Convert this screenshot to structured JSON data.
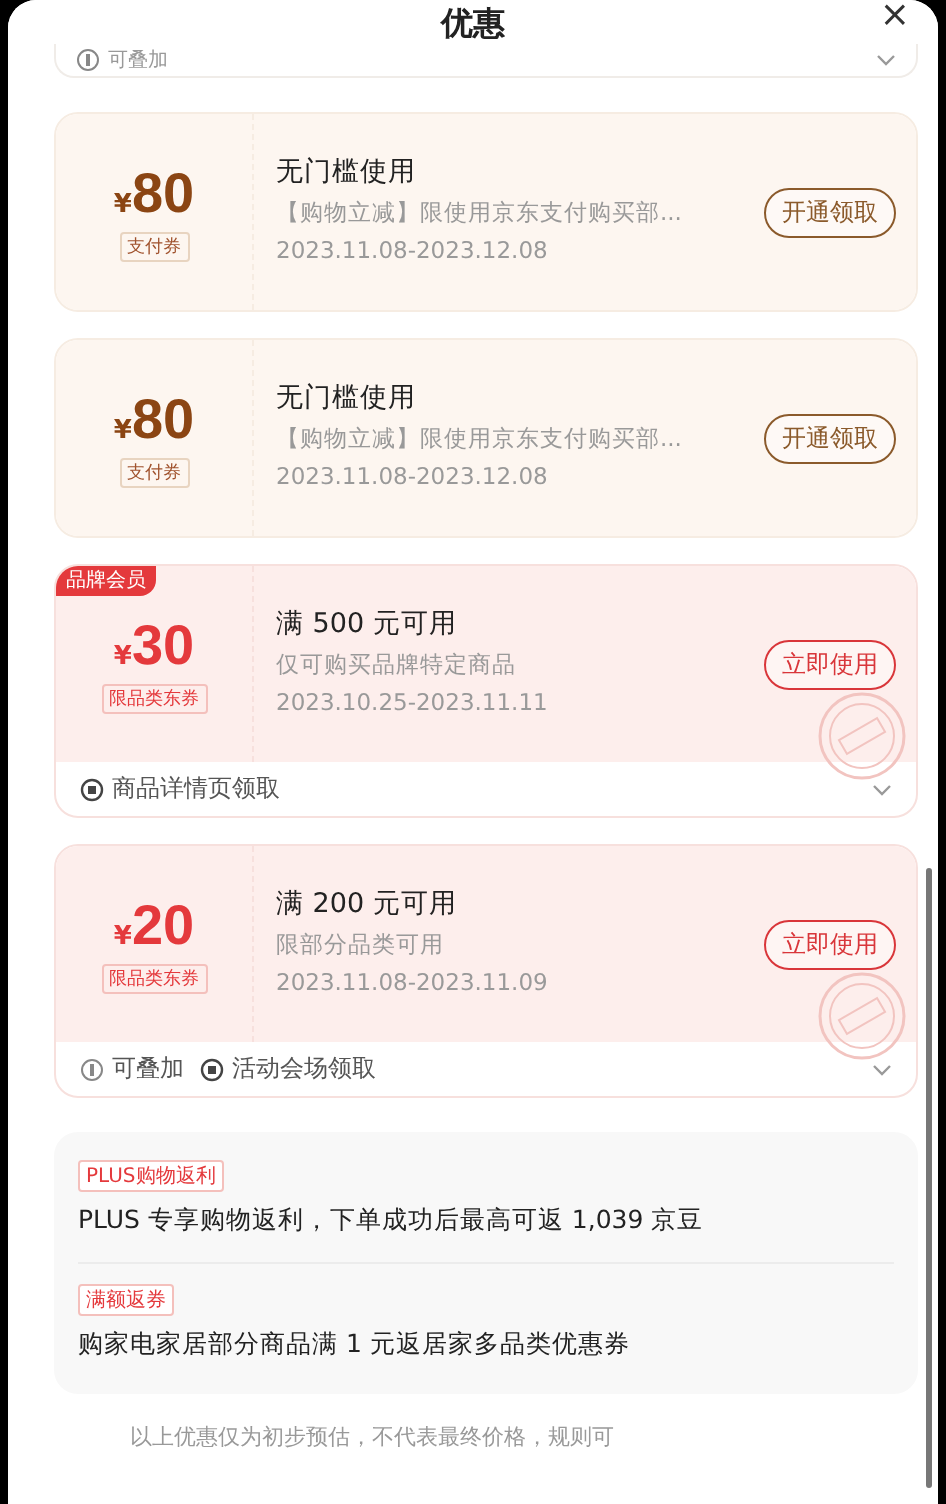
{
  "header": {
    "title": "优惠",
    "close": "×"
  },
  "top_strip": {
    "items": [
      {
        "kind": "stack",
        "label": "可叠加"
      }
    ]
  },
  "coupons": [
    {
      "kind": "pay",
      "currency": "¥",
      "amount": "80",
      "tag": "支付券",
      "title": "无门槛使用",
      "desc": "【购物立减】限使用京东支付购买部...",
      "date": "2023.11.08-2023.12.08",
      "button": "开通领取",
      "stamped": false
    },
    {
      "kind": "pay",
      "currency": "¥",
      "amount": "80",
      "tag": "支付券",
      "title": "无门槛使用",
      "desc": "【购物立减】限使用京东支付购买部...",
      "date": "2023.11.08-2023.12.08",
      "button": "开通领取",
      "stamped": false
    },
    {
      "kind": "goods",
      "badge": "品牌会员",
      "currency": "¥",
      "amount": "30",
      "tag": "限品类东券",
      "title": "满 500 元可用",
      "desc": "仅可购买品牌特定商品",
      "date": "2023.10.25-2023.11.11",
      "button": "立即使用",
      "stamped": true,
      "footer": [
        {
          "kind": "entry",
          "label": "商品详情页领取"
        }
      ]
    },
    {
      "kind": "goods",
      "currency": "¥",
      "amount": "20",
      "tag": "限品类东券",
      "title": "满 200 元可用",
      "desc": "限部分品类可用",
      "date": "2023.11.08-2023.11.09",
      "button": "立即使用",
      "stamped": true,
      "footer": [
        {
          "kind": "stack",
          "label": "可叠加"
        },
        {
          "kind": "entry",
          "label": "活动会场领取"
        }
      ]
    }
  ],
  "benefits": [
    {
      "tag": "PLUS购物返利",
      "text": "PLUS 专享购物返利，下单成功后最高可返 1,039 京豆"
    },
    {
      "tag": "满额返券",
      "text": "购家电家居部分商品满 1 元返居家多品类优惠券"
    }
  ],
  "footnote": "以上优惠仅为初步预估，不代表最终价格，规则可"
}
